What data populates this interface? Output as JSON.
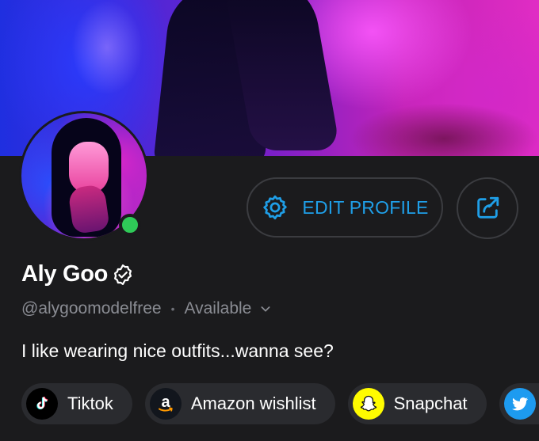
{
  "profile": {
    "name": "Aly Goo",
    "handle": "@alygoomodelfree",
    "separator": "•",
    "status": "Available",
    "bio": "I like wearing nice outfits...wanna see?",
    "online": true
  },
  "actions": {
    "edit_profile_label": "EDIT PROFILE"
  },
  "links": [
    {
      "label": "Tiktok",
      "icon": "tiktok-icon"
    },
    {
      "label": "Amazon wishlist",
      "icon": "amazon-icon"
    },
    {
      "label": "Snapchat",
      "icon": "snapchat-icon"
    },
    {
      "label": "",
      "icon": "twitter-icon"
    }
  ],
  "colors": {
    "accent": "#1f9fe8",
    "background": "#1b1b1d",
    "chip_background": "#2a2b2f",
    "online": "#2fca58",
    "muted_text": "#8a8c93"
  }
}
